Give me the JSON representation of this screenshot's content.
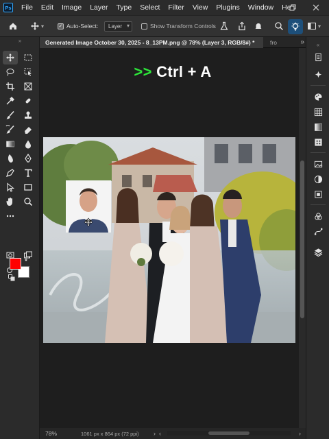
{
  "menubar": {
    "logo": "Ps",
    "items": [
      "File",
      "Edit",
      "Image",
      "Layer",
      "Type",
      "Select",
      "Filter",
      "View",
      "Plugins",
      "Window",
      "He"
    ]
  },
  "options": {
    "auto_select_label": "Auto-Select:",
    "auto_select_checked": true,
    "layer_select_value": "Layer",
    "show_transform_label": "Show Transform Controls",
    "show_transform_checked": false
  },
  "tabs": {
    "active": "Generated Image October 30, 2025 - 8_13PM.png @ 78% (Layer 3, RGB/8#) *",
    "inactive": "fro"
  },
  "overlay": {
    "arrows": ">>",
    "shortcut": "Ctrl + A"
  },
  "colors": {
    "foreground": "#ff0000",
    "background": "#ffffff",
    "shortcut_accent": "#2de83a",
    "app_accent": "#31a8ff"
  },
  "status": {
    "zoom": "78%",
    "doc_info": "1061 px x 864 px (72 ppi)"
  },
  "toolbar_icons": [
    "move-tool-icon",
    "marquee-tool-icon",
    "lasso-tool-icon",
    "object-select-icon",
    "crop-tool-icon",
    "frame-tool-icon",
    "eyedropper-icon",
    "healing-brush-icon",
    "brush-tool-icon",
    "clone-stamp-icon",
    "history-brush-icon",
    "eraser-icon",
    "gradient-tool-icon",
    "blur-tool-icon",
    "dodge-tool-icon",
    "pen-tool-icon",
    "type-tool-icon",
    "path-select-icon",
    "rectangle-tool-icon",
    "hand-tool-icon",
    "zoom-tool-icon",
    "more-tools-icon"
  ],
  "right_panel_icons": [
    "history-panel-icon",
    "ai-sparkle-icon",
    "color-panel-icon",
    "swatches-icon",
    "gradients-icon",
    "patterns-icon",
    "image-panel-icon",
    "adjustments-icon",
    "properties-icon",
    "channels-icon",
    "paths-icon",
    "layers-icon"
  ]
}
